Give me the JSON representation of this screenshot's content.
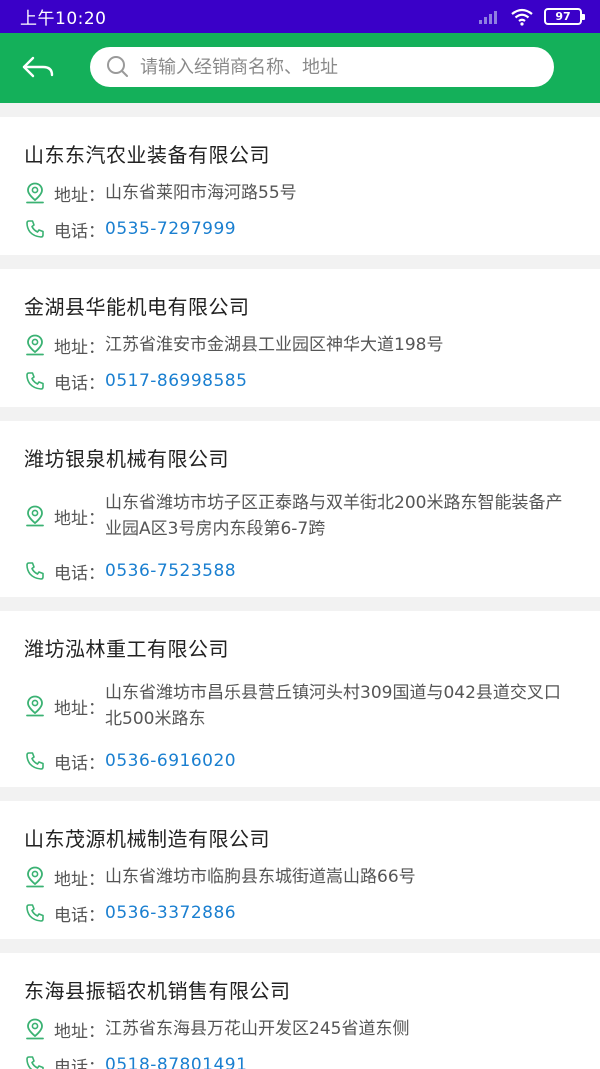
{
  "status": {
    "time": "上午10:20",
    "battery": "97"
  },
  "header": {
    "search_placeholder": "请输入经销商名称、地址"
  },
  "labels": {
    "address": "地址：",
    "phone": "电话："
  },
  "colors": {
    "header": "#14b05a",
    "statusbar": "#3a00c8",
    "phone_link": "#1a7fd0",
    "icon": "#3bb273"
  },
  "dealers": [
    {
      "name": "山东东汽农业装备有限公司",
      "address": "山东省莱阳市海河路55号",
      "phone": "0535-7297999"
    },
    {
      "name": "金湖县华能机电有限公司",
      "address": "江苏省淮安市金湖县工业园区神华大道198号",
      "phone": "0517-86998585"
    },
    {
      "name": "潍坊银泉机械有限公司",
      "address": "山东省潍坊市坊子区正泰路与双羊街北200米路东智能装备产业园A区3号房内东段第6-7跨",
      "phone": "0536-7523588"
    },
    {
      "name": "潍坊泓林重工有限公司",
      "address": "山东省潍坊市昌乐县营丘镇河头村309国道与042县道交叉口北500米路东",
      "phone": "0536-6916020"
    },
    {
      "name": "山东茂源机械制造有限公司",
      "address": "山东省潍坊市临朐县东城街道嵩山路66号",
      "phone": "0536-3372886"
    },
    {
      "name": "东海县振韬农机销售有限公司",
      "address": "江苏省东海县万花山开发区245省道东侧",
      "phone": "0518-87801491"
    }
  ]
}
